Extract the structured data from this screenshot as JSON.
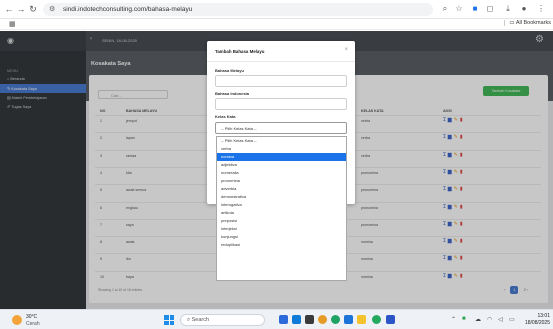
{
  "browser": {
    "url": "sindi.indotechconsulting.com/bahasa-melayu",
    "bookmarks_label": "All Bookmarks"
  },
  "sidebar": {
    "section_label": "MENU",
    "items": [
      {
        "label": "Beranda",
        "active": false
      },
      {
        "label": "Kosakata Saya",
        "active": true
      },
      {
        "label": "Materi Pembelajaran",
        "active": false
      },
      {
        "label": "Tugas Saya",
        "active": false
      }
    ]
  },
  "topbar": {
    "date": "SENIN, 18-08-2025"
  },
  "page": {
    "title": "Kosakata Saya"
  },
  "search": {
    "placeholder": "Cari..."
  },
  "add_button": "Tambah Kosakata",
  "table": {
    "headers": [
      "NO",
      "BAHASA MELAYU",
      "BAHASA INDONESIA",
      "KELAS KATA",
      "AKSI"
    ],
    "rows": [
      {
        "no": "1",
        "melayu": "jemput",
        "kelas": "verba"
      },
      {
        "no": "2",
        "melayu": "lapan",
        "kelas": "verba"
      },
      {
        "no": "3",
        "melayu": "rantaa",
        "kelas": "verba"
      },
      {
        "no": "4",
        "melayu": "kita",
        "kelas": "pronomina"
      },
      {
        "no": "5",
        "melayu": "awak semua",
        "kelas": "pronomina"
      },
      {
        "no": "6",
        "melayu": "engkau",
        "kelas": "pronomina"
      },
      {
        "no": "7",
        "melayu": "saya",
        "kelas": "pronomina"
      },
      {
        "no": "8",
        "melayu": "awak",
        "kelas": "nomina"
      },
      {
        "no": "9",
        "melayu": "ibu",
        "kelas": "nomina"
      },
      {
        "no": "10",
        "melayu": "bapa",
        "kelas": "nomina"
      }
    ],
    "showing": "Showing 1 to 10 of 18 entries"
  },
  "pagination": {
    "prev": "‹",
    "current": "1",
    "next": "2",
    "nextarrow": "›"
  },
  "modal": {
    "title": "Tambah Bahasa Melayu",
    "close": "×",
    "field1_label": "Bahasa Melayu",
    "field2_label": "Bahasa Indonesia",
    "field3_label": "Kelas Kata",
    "select_value": "-- Pilih Kelas Kata --"
  },
  "dropdown": {
    "options": [
      "-- Pilih Kelas Kata --",
      "verba",
      "nomina",
      "adjektiva",
      "numeralia",
      "pronomina",
      "adverbia",
      "demonstrativa",
      "interogativa",
      "artikula",
      "preposisi",
      "interjeksi",
      "konjungsi",
      "reduplikasi"
    ],
    "selected_index": 2
  },
  "taskbar": {
    "weather_temp": "30°C",
    "weather_desc": "Cerah",
    "search_label": "Search",
    "time": "13:01",
    "date": "18/08/2025"
  },
  "colors": {
    "accent": "#4a7bd0",
    "add_button": "#42b958",
    "selected_option": "#1a73e8"
  }
}
